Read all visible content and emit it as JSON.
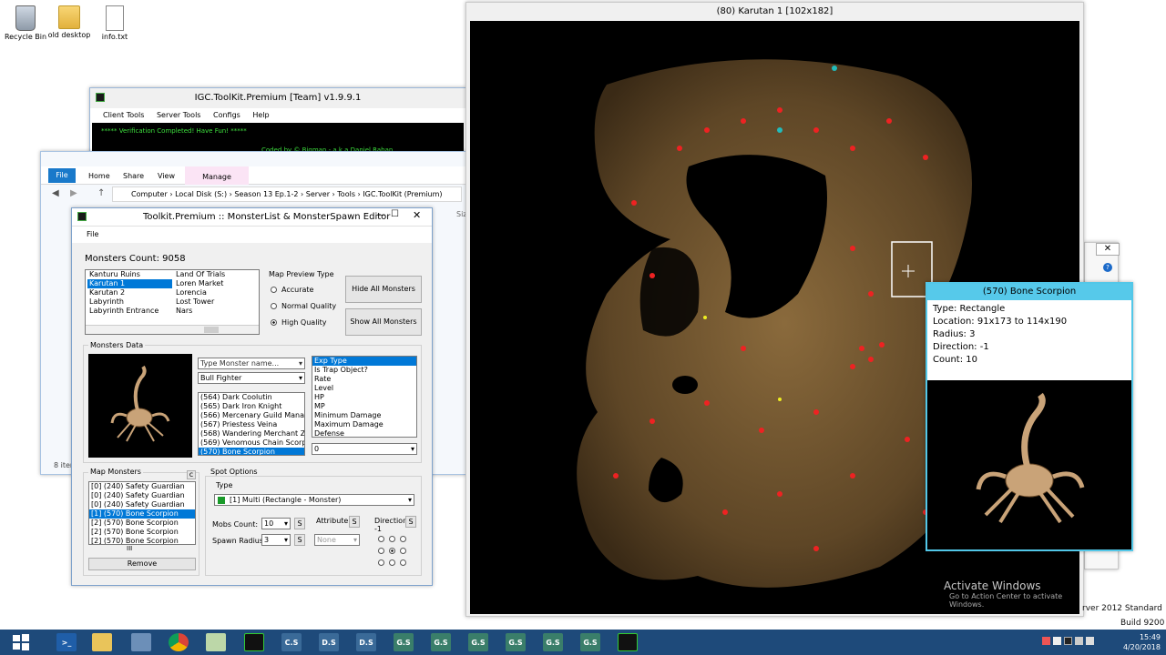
{
  "desktop": {
    "icons": [
      {
        "label": "Recycle Bin"
      },
      {
        "label": "old desktop"
      },
      {
        "label": "info.txt"
      }
    ],
    "watermark_title": "Activate Windows",
    "watermark_sub": "Go to Action Center to activate Windows.",
    "server_line1": "rver 2012 Standard",
    "server_line2": "Build 9200"
  },
  "toolkit": {
    "title": "IGC.ToolKit.Premium [Team] v1.9.9.1",
    "menu": [
      "Client Tools",
      "Server Tools",
      "Configs",
      "Help"
    ],
    "status": "***** Verification Completed! Have Fun! *****",
    "credit": "Coded by © Bigman - a.k.a Daniel Raban"
  },
  "explorer": {
    "ribbon_tabs": [
      "File",
      "Home",
      "Share",
      "View",
      "Manage"
    ],
    "path": [
      "Computer",
      "Local Disk (S:)",
      "Season 13 Ep.1-2",
      "Server",
      "Tools",
      "IGC.ToolKit (Premium)"
    ],
    "status": "8 item",
    "col_partial": "Siz"
  },
  "editor": {
    "title": "Toolkit.Premium :: MonsterList & MonsterSpawn Editor",
    "menu_file": "File",
    "monsters_count": "Monsters Count: 9058",
    "maps_col1": [
      "Kanturu Ruins",
      "Karutan 1",
      "Karutan 2",
      "Labyrinth",
      "Labyrinth Entrance"
    ],
    "maps_col2": [
      "Land Of Trials",
      "Loren Market",
      "Lorencia",
      "Lost Tower",
      "Nars"
    ],
    "preview_label": "Map Preview Type",
    "preview_options": [
      "Accurate",
      "Normal Quality",
      "High Quality"
    ],
    "hide_all": "Hide All Monsters",
    "show_all": "Show All Monsters",
    "monsters_data_label": "Monsters Data",
    "type_placeholder": "Type Monster name...",
    "type_combo": "Bull Fighter",
    "monster_list": [
      "(564) Dark Coolutin",
      "(565) Dark Iron Knight",
      "(566) Mercenary Guild Manag",
      "(567) Priestess Veina",
      "(568) Wandering Merchant Zy",
      "(569) Venomous Chain Scorpi",
      "(570) Bone Scorpion"
    ],
    "attr_list": [
      "Exp Type",
      "Is Trap Object?",
      "Rate",
      "Level",
      "HP",
      "MP",
      "Minimum Damage",
      "Maximum Damage",
      "Defense"
    ],
    "attr_value": "0",
    "map_monsters_label": "Map Monsters",
    "map_monsters": [
      "[0] (240) Safety Guardian",
      "[0] (240) Safety Guardian",
      "[0] (240) Safety Guardian",
      "[1] (570) Bone Scorpion",
      "[2] (570) Bone Scorpion",
      "[2] (570) Bone Scorpion",
      "[2] (570) Bone Scorpion"
    ],
    "scroll_marker": "III",
    "remove": "Remove",
    "spot_label": "Spot Options",
    "type_label": "Type",
    "spot_type": "[1] Multi (Rectangle - Monster)",
    "mobs_label": "Mobs Count:",
    "mobs_value": "10",
    "radius_label": "Spawn Radius:",
    "radius_value": "3",
    "attribute_label": "Attribute",
    "attribute_value": "None",
    "direction_label": "Direction",
    "direction_value": "-1",
    "s_glyph": "S",
    "clear_glyph": "c"
  },
  "map": {
    "title": "(80) Karutan 1     [102x182]"
  },
  "popup": {
    "title": "(570) Bone Scorpion",
    "lines": [
      "Type: Rectangle",
      "Location: 91x173 to 114x190",
      "Radius: 3",
      "Direction: -1",
      "Count: 10"
    ]
  },
  "taskbar": {
    "tiles": [
      "C.S",
      "D.S",
      "D.S",
      "G.S",
      "G.S",
      "G.S",
      "G.S",
      "G.S",
      "G.S"
    ],
    "time": "15:49",
    "date": "4/20/2018"
  }
}
